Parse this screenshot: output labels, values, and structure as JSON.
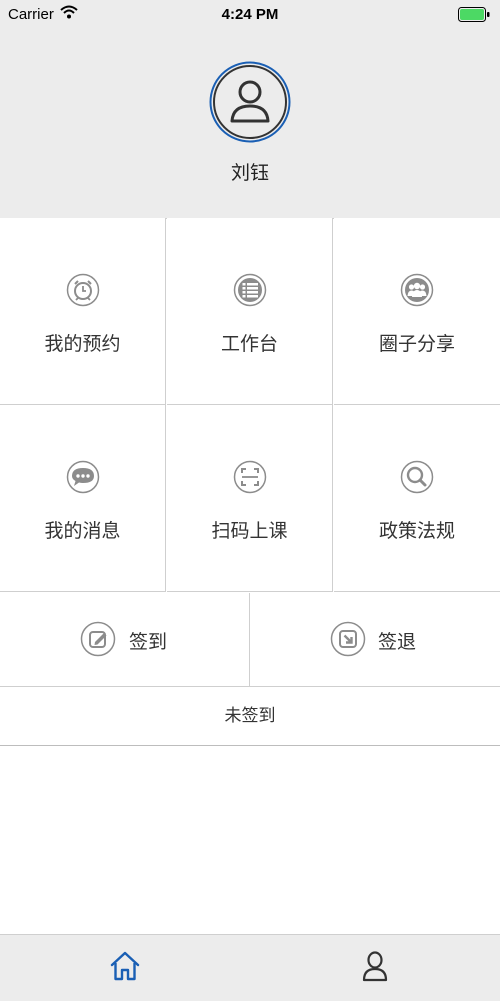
{
  "status_bar": {
    "carrier": "Carrier",
    "time": "4:24 PM"
  },
  "profile": {
    "name": "刘钰"
  },
  "grid": {
    "items": [
      {
        "label": "我的预约",
        "icon": "alarm-clock-icon"
      },
      {
        "label": "工作台",
        "icon": "list-icon"
      },
      {
        "label": "圈子分享",
        "icon": "group-icon"
      },
      {
        "label": "我的消息",
        "icon": "chat-bubble-icon"
      },
      {
        "label": "扫码上课",
        "icon": "scan-icon"
      },
      {
        "label": "政策法规",
        "icon": "search-icon"
      }
    ]
  },
  "sign": {
    "sign_in_label": "签到",
    "sign_out_label": "签退"
  },
  "sign_status": "未签到",
  "tabs": [
    {
      "icon": "home-icon",
      "active": true
    },
    {
      "icon": "user-icon",
      "active": false
    }
  ],
  "colors": {
    "accent": "#1a5fb4",
    "icon_gray": "#8c8c8c",
    "header_bg": "#ececec",
    "battery_green": "#4cd964"
  }
}
